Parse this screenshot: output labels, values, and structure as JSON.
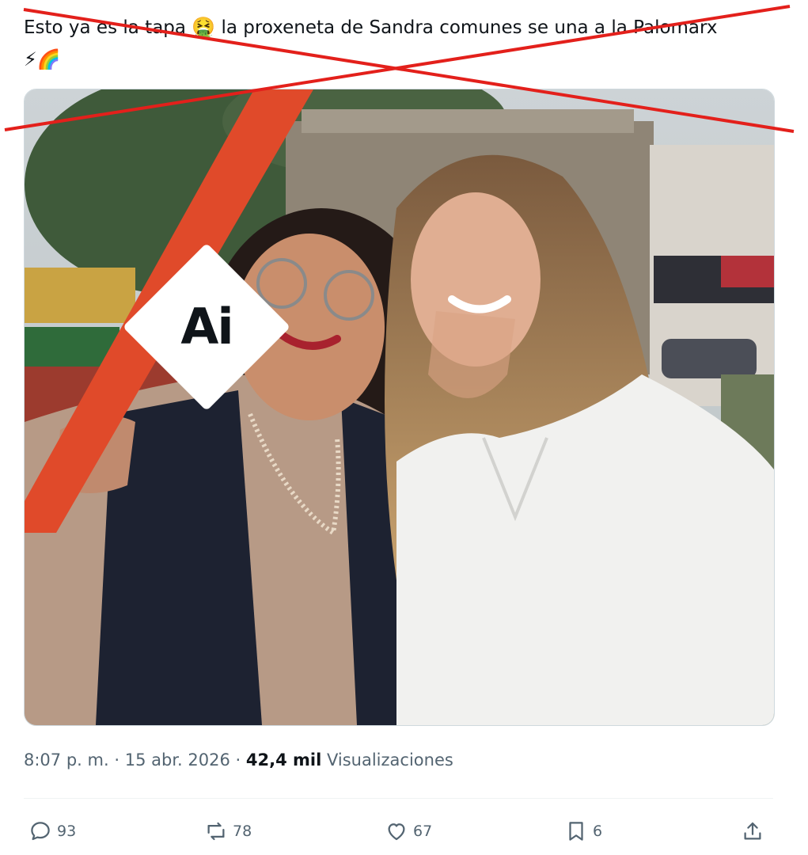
{
  "tweet": {
    "text_part1": "Esto ya es la tapa",
    "emoji1": "🤮",
    "text_part2": "la proxeneta de Sandra comunes se una a la Palomarx",
    "emoji2": "⚡🌈"
  },
  "image": {
    "badge_label": "Ai",
    "stripe_color": "#e04a2a"
  },
  "meta": {
    "time": "8:07 p. m.",
    "sep1": "·",
    "date": "15 abr. 2026",
    "sep2": "·",
    "views_count": "42,4 mil",
    "views_label": "Visualizaciones"
  },
  "actions": {
    "replies": "93",
    "reposts": "78",
    "likes": "67",
    "bookmarks": "6"
  },
  "overlay": {
    "cross_color": "#e3201b"
  }
}
